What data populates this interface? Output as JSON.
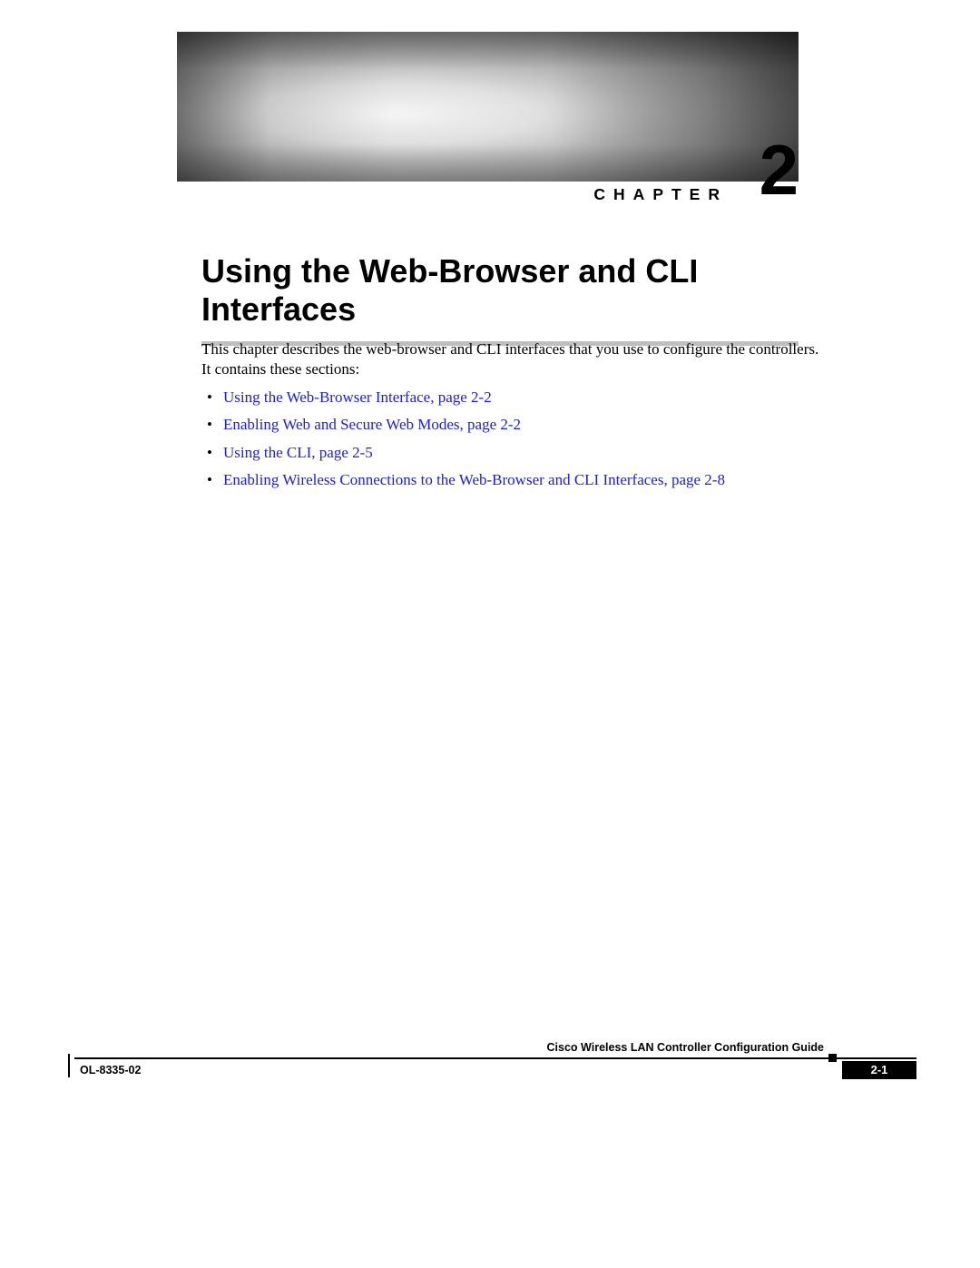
{
  "header": {
    "chapter_label": "CHAPTER",
    "chapter_number": "2",
    "title": "Using the Web-Browser and CLI Interfaces"
  },
  "intro": "This chapter describes the web-browser and CLI interfaces that you use to configure the controllers. It contains these sections:",
  "bullets": [
    "Using the Web-Browser Interface, page 2-2",
    "Enabling Web and Secure Web Modes, page 2-2",
    "Using the CLI, page 2-5",
    "Enabling Wireless Connections to the Web-Browser and CLI Interfaces, page 2-8"
  ],
  "footer": {
    "guide": "Cisco Wireless LAN Controller Configuration Guide",
    "doc": "OL-8335-02",
    "page": "2-1"
  }
}
